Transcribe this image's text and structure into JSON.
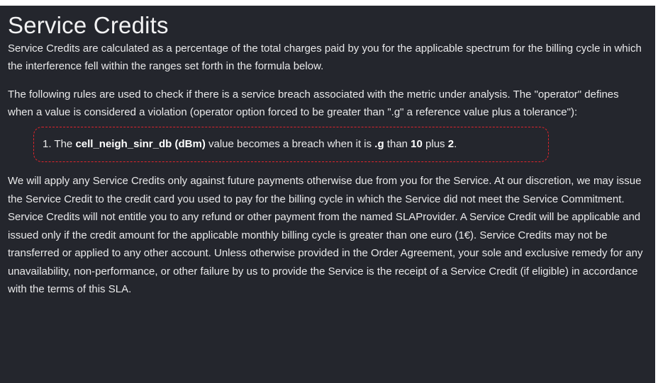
{
  "title": "Service Credits",
  "paragraph1": "Service Credits are calculated as a percentage of the total charges paid by you for the applicable spectrum for the billing cycle in which the interference fell within the ranges set forth in the formula below.",
  "paragraph2": "The following rules are used to check if there is a service breach associated with the metric under analysis. The \"operator\" defines when a value is considered a violation (operator option forced to be greater than \".g\" a reference value plus a tolerance\"):",
  "rule": {
    "number": "1.",
    "pre": " The ",
    "metric": "cell_neigh_sinr_db",
    "unit": "(dBm)",
    "mid": " value becomes a breach when it is ",
    "operator": ".g",
    "than": " than ",
    "value": "10",
    "plus": " plus ",
    "tolerance": "2",
    "end": "."
  },
  "paragraph3": "We will apply any Service Credits only against future payments otherwise due from you for the Service. At our discretion, we may issue the Service Credit to the credit card you used to pay for the billing cycle in which the Service did not meet the Service Commitment. Service Credits will not entitle you to any refund or other payment from the named SLAProvider. A Service Credit will be applicable and issued only if the credit amount for the applicable monthly billing cycle is greater than one euro (1€). Service Credits may not be transferred or applied to any other account. Unless otherwise provided in the Order Agreement, your sole and exclusive remedy for any unavailability, non-performance, or other failure by us to provide the Service is the receipt of a Service Credit (if eligible) in accordance with the terms of this SLA.",
  "colors": {
    "background": "#24262d",
    "text": "#e9e9ea",
    "highlight_border": "#e0242c"
  }
}
